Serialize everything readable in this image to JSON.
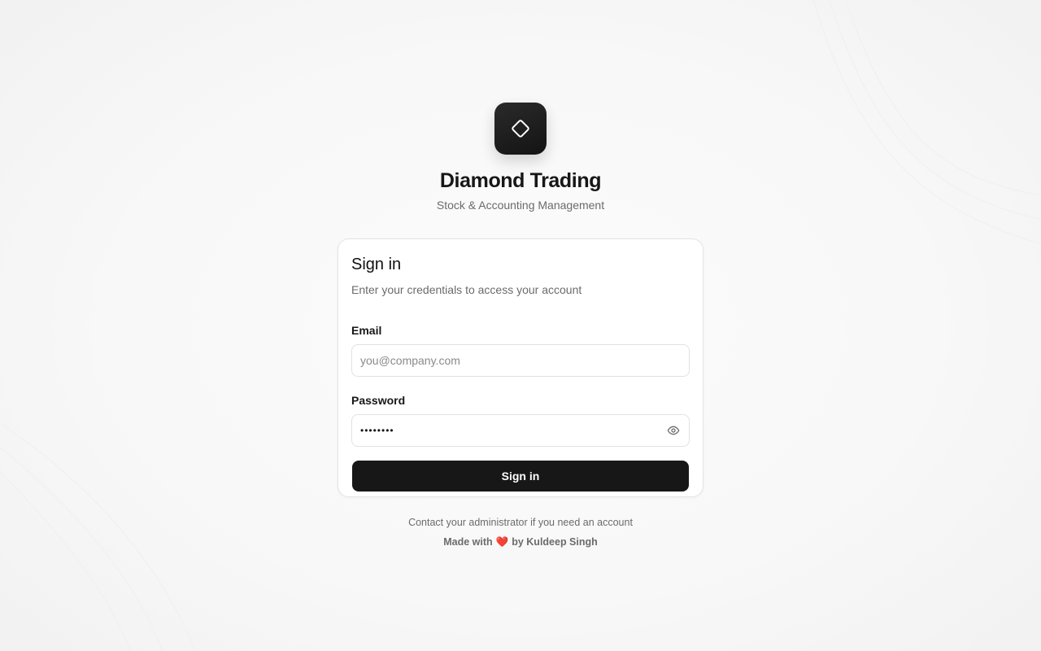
{
  "brand": {
    "logo_icon": "diamond-icon",
    "title": "Diamond Trading",
    "subtitle": "Stock & Accounting Management"
  },
  "card": {
    "title": "Sign in",
    "description": "Enter your credentials to access your account",
    "email": {
      "label": "Email",
      "placeholder": "you@company.com",
      "value": ""
    },
    "password": {
      "label": "Password",
      "value": "••••••••",
      "toggle_icon": "eye-icon"
    },
    "submit_label": "Sign in"
  },
  "footer": {
    "note": "Contact your administrator if you need an account",
    "credit_prefix": "Made with",
    "heart": "❤️",
    "credit_suffix": "by Kuldeep Singh"
  },
  "colors": {
    "primary": "#171717",
    "muted_text": "#6b6b6b",
    "border": "#e4e4e4",
    "heart": "#e53935"
  }
}
